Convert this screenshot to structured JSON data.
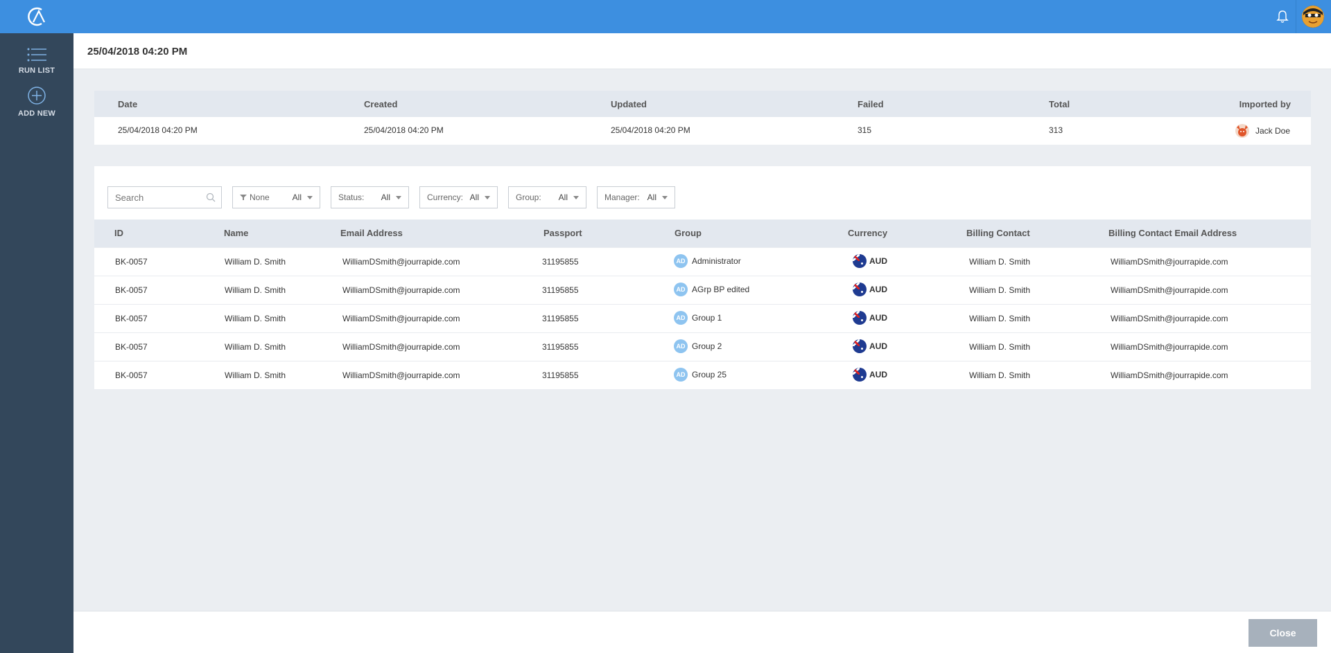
{
  "sidebar": {
    "items": [
      {
        "label": "RUN LIST",
        "icon": "list-icon"
      },
      {
        "label": "ADD NEW",
        "icon": "plus-circle-icon"
      }
    ]
  },
  "header": {
    "title": "25/04/2018 04:20 PM"
  },
  "summary": {
    "headers": [
      "Date",
      "Created",
      "Updated",
      "Failed",
      "Total",
      "Imported by"
    ],
    "values": {
      "date": "25/04/2018 04:20 PM",
      "created": "25/04/2018 04:20 PM",
      "updated": "25/04/2018 04:20 PM",
      "failed": "315",
      "total": "313",
      "imported_by": "Jack Doe"
    }
  },
  "filters": {
    "search_placeholder": "Search",
    "items": [
      {
        "label": "None",
        "value": "All"
      },
      {
        "label": "Status:",
        "value": "All"
      },
      {
        "label": "Currency:",
        "value": "All"
      },
      {
        "label": "Group:",
        "value": "All"
      },
      {
        "label": "Manager:",
        "value": "All"
      }
    ]
  },
  "table": {
    "columns": [
      "ID",
      "Name",
      "Email Address",
      "Passport",
      "Group",
      "Currency",
      "Billing Contact",
      "Billing Contact Email Address"
    ],
    "rows": [
      {
        "id": "BK-0057",
        "name": "William D. Smith",
        "email": "WilliamDSmith@jourrapide.com",
        "passport": "31195855",
        "group_badge": "AD",
        "group": "Administrator",
        "currency": "AUD",
        "billing_contact": "William D. Smith",
        "billing_email": "WilliamDSmith@jourrapide.com"
      },
      {
        "id": "BK-0057",
        "name": "William D. Smith",
        "email": "WilliamDSmith@jourrapide.com",
        "passport": "31195855",
        "group_badge": "AD",
        "group": "AGrp BP edited",
        "currency": "AUD",
        "billing_contact": "William D. Smith",
        "billing_email": "WilliamDSmith@jourrapide.com"
      },
      {
        "id": "BK-0057",
        "name": "William D. Smith",
        "email": "WilliamDSmith@jourrapide.com",
        "passport": "31195855",
        "group_badge": "AD",
        "group": "Group 1",
        "currency": "AUD",
        "billing_contact": "William D. Smith",
        "billing_email": "WilliamDSmith@jourrapide.com"
      },
      {
        "id": "BK-0057",
        "name": "William D. Smith",
        "email": "WilliamDSmith@jourrapide.com",
        "passport": "31195855",
        "group_badge": "AD",
        "group": "Group 2",
        "currency": "AUD",
        "billing_contact": "William D. Smith",
        "billing_email": "WilliamDSmith@jourrapide.com"
      },
      {
        "id": "BK-0057",
        "name": "William D. Smith",
        "email": "WilliamDSmith@jourrapide.com",
        "passport": "31195855",
        "group_badge": "AD",
        "group": "Group 25",
        "currency": "AUD",
        "billing_contact": "William D. Smith",
        "billing_email": "WilliamDSmith@jourrapide.com"
      }
    ]
  },
  "footer": {
    "close_label": "Close"
  },
  "colors": {
    "topbar": "#3d8fe0",
    "sidebar": "#33475b",
    "close_button": "#a7b1bc"
  }
}
